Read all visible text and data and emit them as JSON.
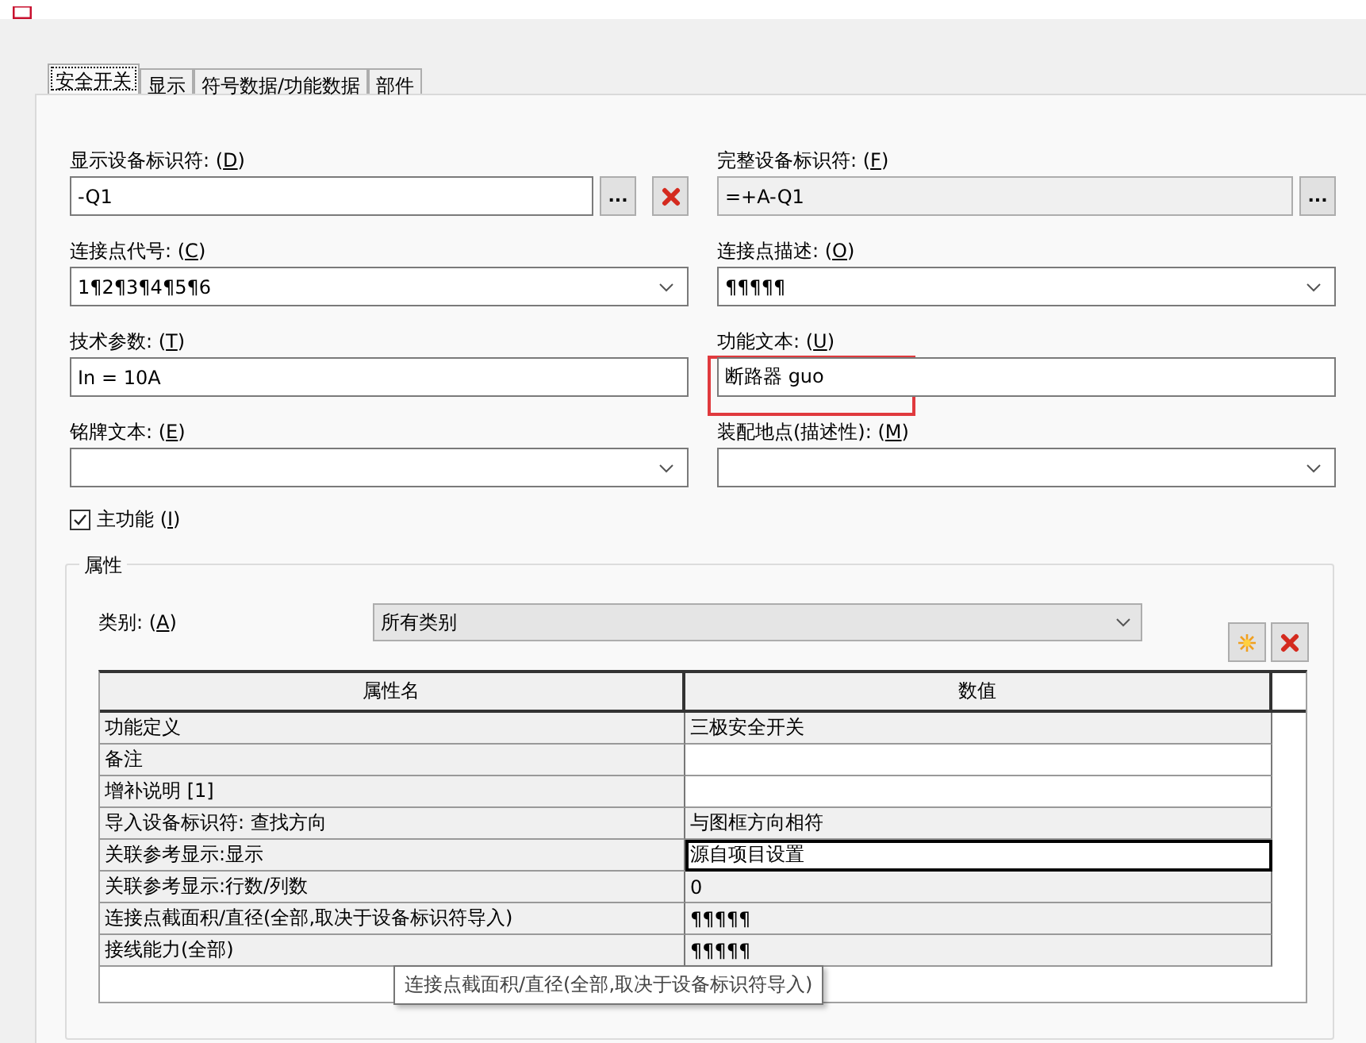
{
  "tabs": [
    {
      "label": "安全开关",
      "selected": true
    },
    {
      "label": "显示",
      "selected": false
    },
    {
      "label": "符号数据/功能数据",
      "selected": false
    },
    {
      "label": "部件",
      "selected": false
    }
  ],
  "fields": [
    {
      "label": "显示设备标识符: (D)",
      "kind": "text",
      "value": "-Q1",
      "disabled": false,
      "browse": "...",
      "clear": true
    },
    {
      "label": "完整设备标识符: (F)",
      "kind": "text",
      "value": "=+A-Q1",
      "disabled": true,
      "browse": "..."
    },
    {
      "label": "连接点代号: (C)",
      "kind": "combo",
      "value": "1¶2¶3¶4¶5¶6",
      "disabled": false
    },
    {
      "label": "连接点描述: (O)",
      "kind": "combo",
      "value": "¶¶¶¶¶",
      "disabled": false
    },
    {
      "label": "技术参数: (T)",
      "kind": "text",
      "value": "In = 10A",
      "disabled": false
    },
    {
      "label": "功能文本: (U)",
      "kind": "text",
      "value": "断路器  guo",
      "disabled": false,
      "highlight": true
    },
    {
      "label": "铭牌文本: (E)",
      "kind": "combo",
      "disabled": false
    },
    {
      "label": "装配地点(描述性): (M)",
      "kind": "combo",
      "disabled": false
    }
  ],
  "main_function": {
    "label": "主功能 (I)",
    "checked": true
  },
  "properties": {
    "title": "属性",
    "category_label": "类别: (A)",
    "category_value": "所有类别",
    "columns": [
      "属性名",
      "数值"
    ],
    "rows": [
      {
        "name": "功能定义",
        "value": "三极安全开关",
        "editable": false,
        "selected": false
      },
      {
        "name": "备注",
        "value": "",
        "editable": true,
        "selected": false
      },
      {
        "name": "增补说明 [1]",
        "value": "",
        "editable": true,
        "selected": false
      },
      {
        "name": "导入设备标识符: 查找方向",
        "value": "与图框方向相符",
        "editable": false,
        "selected": false
      },
      {
        "name": "关联参考显示:显示",
        "value": "源自项目设置",
        "editable": true,
        "selected": true
      },
      {
        "name": "关联参考显示:行数/列数",
        "value": "0",
        "editable": false,
        "selected": false
      },
      {
        "name": "连接点截面积/直径(全部,取决于设备标识符导入)",
        "value": "¶¶¶¶¶",
        "editable": false,
        "selected": false
      },
      {
        "name": "接线能力(全部)",
        "value": "¶¶¶¶¶",
        "editable": false,
        "selected": false
      }
    ],
    "tooltip": "连接点截面积/直径(全部,取决于设备标识符导入)"
  }
}
